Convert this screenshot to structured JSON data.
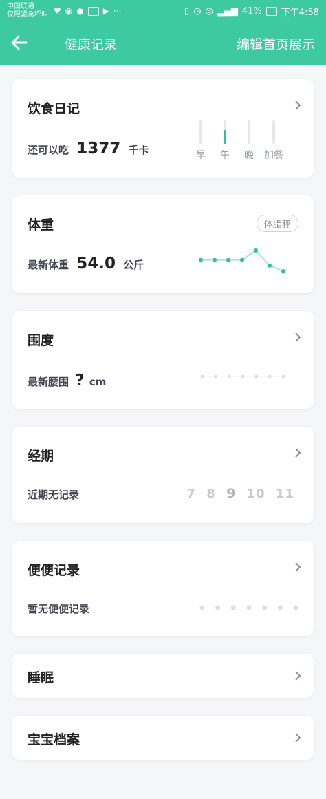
{
  "status": {
    "carrier_line1": "中国联通",
    "carrier_line2": "仅限紧急呼叫",
    "more": "···",
    "battery": "41%",
    "time": "下午4:58"
  },
  "nav": {
    "title": "健康记录",
    "edit": "编辑首页展示"
  },
  "diet": {
    "title": "饮食日记",
    "label": "还可以吃",
    "value": "1377",
    "unit": "千卡",
    "meals": [
      {
        "label": "早",
        "filled": false
      },
      {
        "label": "午",
        "filled": true
      },
      {
        "label": "晚",
        "filled": false
      },
      {
        "label": "加餐",
        "filled": false
      }
    ]
  },
  "weight": {
    "title": "体重",
    "tag": "体脂秤",
    "label": "最新体重",
    "value": "54.0",
    "unit": "公斤",
    "trend": [
      54.4,
      54.4,
      54.4,
      54.4,
      54.9,
      54.1,
      53.8
    ],
    "trend_color": "#2fc19a"
  },
  "girth": {
    "title": "围度",
    "label": "最新腰围",
    "value": "?",
    "unit": "cm"
  },
  "period": {
    "title": "经期",
    "label": "近期无记录",
    "dates": [
      "7",
      "8",
      "9",
      "10",
      "11"
    ]
  },
  "bowel": {
    "title": "便便记录",
    "label": "暂无便便记录"
  },
  "sleep": {
    "title": "睡眠"
  },
  "baby": {
    "title": "宝宝档案"
  },
  "colors": {
    "accent": "#3ecaa1"
  }
}
